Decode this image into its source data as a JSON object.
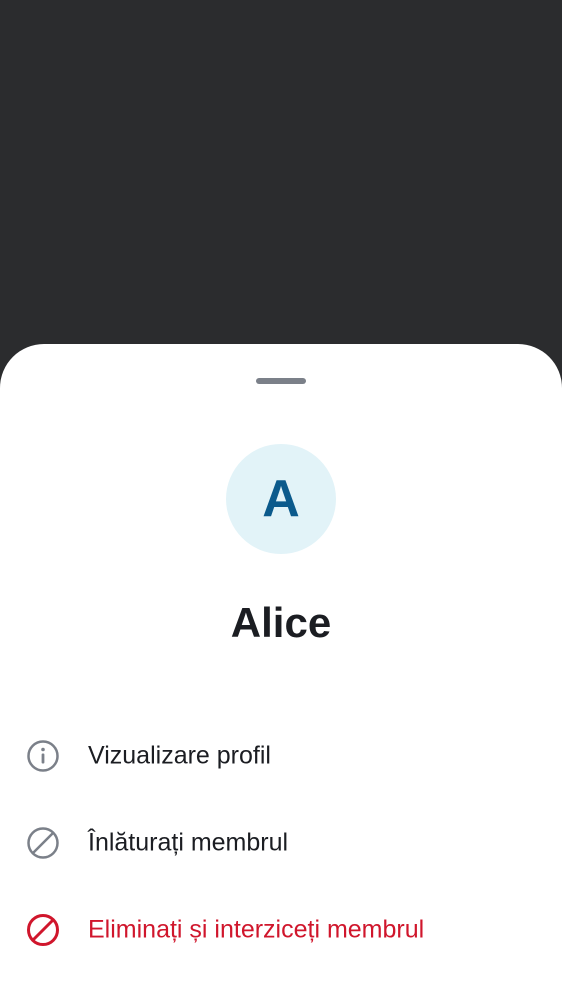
{
  "member": {
    "initial": "A",
    "name": "Alice"
  },
  "actions": [
    {
      "label": "Vizualizare profil",
      "icon": "info-icon"
    },
    {
      "label": "Înlăturați membrul",
      "icon": "remove-icon"
    },
    {
      "label": "Eliminați și interziceți membrul",
      "icon": "ban-icon",
      "style": "danger"
    }
  ],
  "colors": {
    "scrim": "#2b2c2e",
    "sheet": "#ffffff",
    "avatar_bg": "#e2f3f8",
    "avatar_text": "#0b5a8c",
    "danger": "#d0162c",
    "icon_gray": "#7b8089"
  }
}
